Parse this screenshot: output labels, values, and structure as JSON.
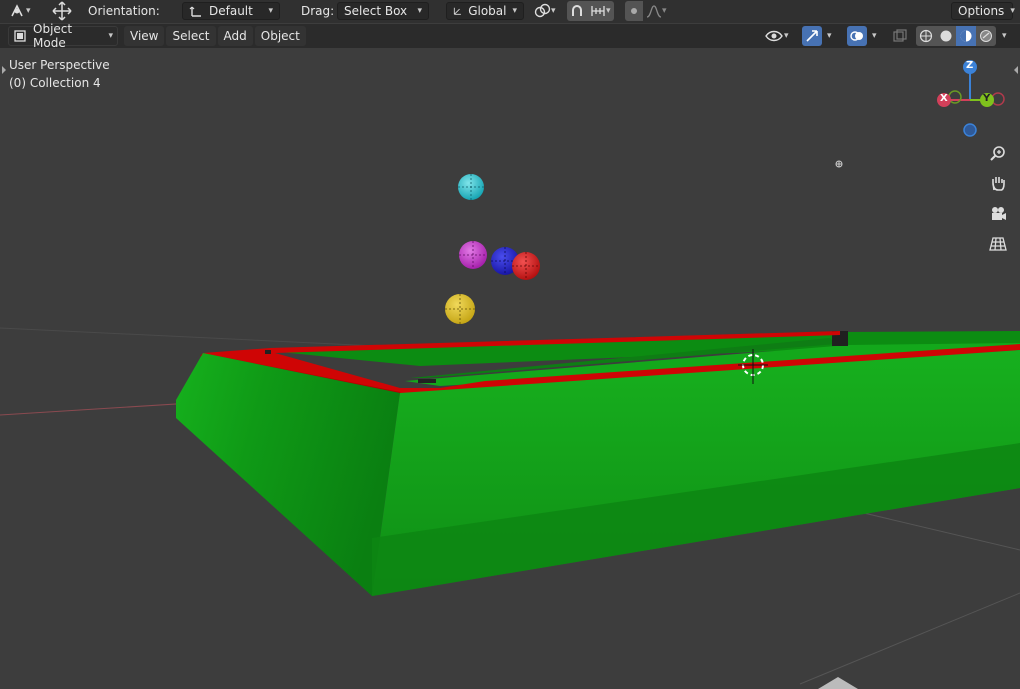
{
  "tool_header": {
    "orientation_label": "Orientation:",
    "orientation_value": "Default",
    "drag_label": "Drag:",
    "drag_value": "Select Box",
    "transform_orientation": "Global",
    "options_label": "Options"
  },
  "view_header": {
    "mode": "Object Mode",
    "menus": [
      "View",
      "Select",
      "Add",
      "Object"
    ]
  },
  "viewport": {
    "perspective": "User Perspective",
    "collection": "(0) Collection 4",
    "gizmo": {
      "z": "Z",
      "x": "X",
      "y": "Y"
    }
  },
  "icons": {
    "tool": "select-tool-icon",
    "move": "move-icon",
    "pivot": "pivot-icon",
    "orientation": "transform-orientation-icon",
    "snap": "snap-icon",
    "proportional": "proportional-edit-icon",
    "visibility": "visibility-icon",
    "gizmo_toggle": "gizmo-icon",
    "overlay": "overlay-icon",
    "xray": "xray-icon",
    "shading": [
      "wireframe-shading-icon",
      "solid-shading-icon",
      "material-shading-icon",
      "rendered-shading-icon"
    ],
    "zoom": "zoom-icon",
    "pan": "hand-pan-icon",
    "camera": "camera-icon",
    "grid": "grid-view-icon"
  },
  "colors": {
    "header_bg": "#303030",
    "viewport_bg": "#3d3d3d",
    "table_green": "#13a51a",
    "rail_red": "#d10000",
    "axis_x": "#d2405a",
    "axis_y": "#7fc11d",
    "axis_z": "#3b82d8",
    "accent": "#4772b3"
  }
}
